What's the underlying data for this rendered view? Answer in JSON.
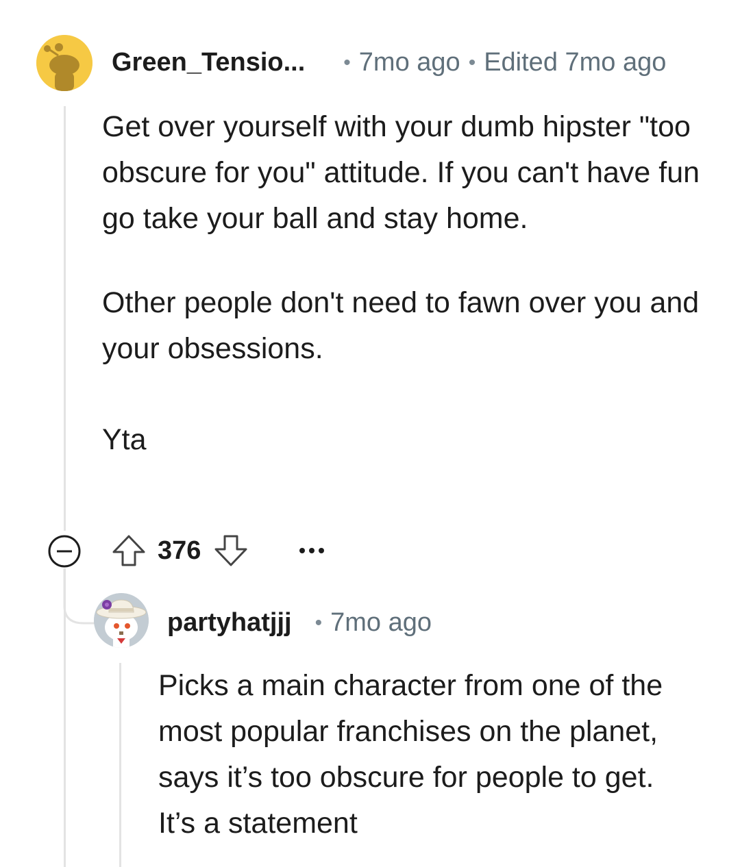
{
  "comment": {
    "username": "Green_Tensio...",
    "age": "7mo ago",
    "edited": "Edited 7mo ago",
    "paragraphs": [
      "Get over yourself with your dumb hipster \"too obscure for you\" attitude. If you can't have fun go take your ball and stay home.",
      "Other people don't need to fawn over you and your obsessions.",
      "Yta"
    ],
    "score": "376",
    "colors": {
      "avatar_bg": "#f6c944",
      "avatar_figure": "#b0892a"
    },
    "icons": [
      "collapse-icon",
      "upvote-icon",
      "downvote-icon",
      "more-options-icon"
    ]
  },
  "reply": {
    "username": "partyhatjjj",
    "age": "7mo ago",
    "text": "Picks a main character from one of the most popular franchises on the planet, says it’s too obscure for people to get. It’s a statement",
    "colors": {
      "avatar_bg": "#c3ccd3",
      "hat": "#f4efe3",
      "flower": "#7b3ea3"
    }
  }
}
